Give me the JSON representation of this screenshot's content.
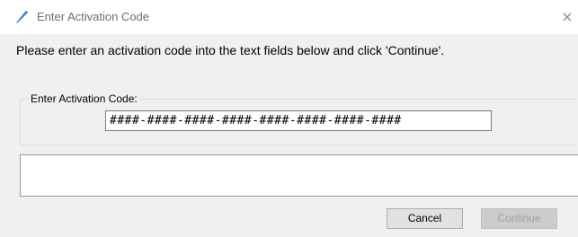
{
  "window": {
    "title": "Enter Activation Code",
    "close_glyph": "×",
    "icon": "pencil-icon"
  },
  "instruction": "Please enter an activation code into the text fields below and click 'Continue'.",
  "activation_group": {
    "label": "Enter Activation Code:",
    "code_value": "####-####-####-####-####-####-####-####"
  },
  "message_area": {
    "text": ""
  },
  "buttons": {
    "cancel_label": "Cancel",
    "continue_label": "Continue",
    "continue_enabled": false
  },
  "colors": {
    "window_bg": "#f0f0f0",
    "titlebar_bg": "#ffffff",
    "icon_accent": "#4a7cc9"
  }
}
